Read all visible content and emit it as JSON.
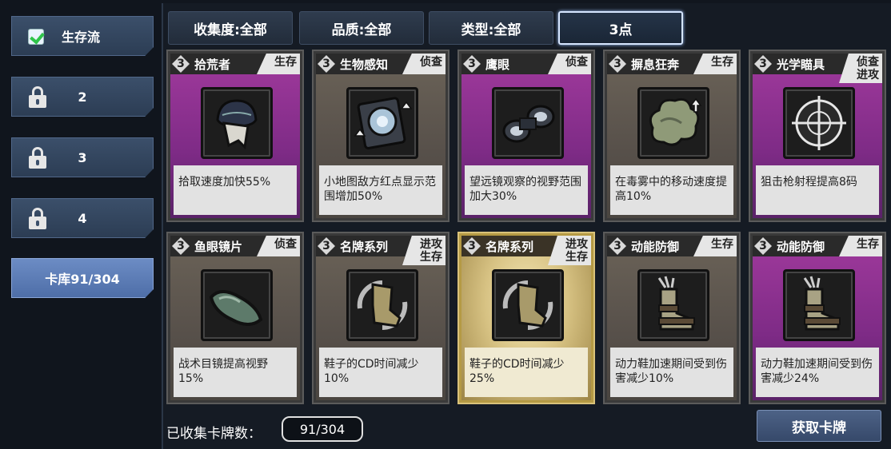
{
  "sidebar": {
    "items": [
      {
        "label": "生存流",
        "state": "checked"
      },
      {
        "label": "2",
        "state": "locked"
      },
      {
        "label": "3",
        "state": "locked"
      },
      {
        "label": "4",
        "state": "locked"
      },
      {
        "label": "卡库91/304",
        "state": "active"
      }
    ]
  },
  "filters": [
    {
      "label": "收集度:全部"
    },
    {
      "label": "品质:全部"
    },
    {
      "label": "类型:全部"
    },
    {
      "label": "3点",
      "selected": true
    }
  ],
  "cards": [
    {
      "cost": "3",
      "name": "拾荒者",
      "tag1": "生存",
      "tag2": "",
      "desc": "拾取速度加快55%",
      "style": "purple",
      "icon": "hood-mask-icon"
    },
    {
      "cost": "3",
      "name": "生物感知",
      "tag1": "侦查",
      "tag2": "",
      "desc": "小地图敌方红点显示范围增加50%",
      "style": "gray",
      "icon": "radar-device-icon"
    },
    {
      "cost": "3",
      "name": "鹰眼",
      "tag1": "侦查",
      "tag2": "",
      "desc": "望远镜观察的视野范围加大30%",
      "style": "purple",
      "icon": "binoculars-icon"
    },
    {
      "cost": "3",
      "name": "摒息狂奔",
      "tag1": "生存",
      "tag2": "",
      "desc": "在毒雾中的移动速度提高10%",
      "style": "gray",
      "icon": "gas-cloud-icon"
    },
    {
      "cost": "3",
      "name": "光学瞄具",
      "tag1": "侦查",
      "tag2": "进攻",
      "desc": "狙击枪射程提高8码",
      "style": "purple",
      "icon": "crosshair-scope-icon"
    },
    {
      "cost": "3",
      "name": "鱼眼镜片",
      "tag1": "侦查",
      "tag2": "",
      "desc": "战术目镜提高视野15%",
      "style": "gray",
      "icon": "goggles-icon"
    },
    {
      "cost": "3",
      "name": "名牌系列",
      "tag1": "进攻",
      "tag2": "生存",
      "desc": "鞋子的CD时间减少10%",
      "style": "gray",
      "icon": "boot-cooldown-icon"
    },
    {
      "cost": "3",
      "name": "名牌系列",
      "tag1": "进攻",
      "tag2": "生存",
      "desc": "鞋子的CD时间减少25%",
      "style": "gold",
      "icon": "boot-cooldown-icon"
    },
    {
      "cost": "3",
      "name": "动能防御",
      "tag1": "生存",
      "tag2": "",
      "desc": "动力鞋加速期间受到伤害减少10%",
      "style": "gray",
      "icon": "armored-boot-icon"
    },
    {
      "cost": "3",
      "name": "动能防御",
      "tag1": "生存",
      "tag2": "",
      "desc": "动力鞋加速期间受到伤害减少24%",
      "style": "purple",
      "icon": "armored-boot-icon"
    }
  ],
  "footer": {
    "collected_label": "已收集卡牌数：",
    "collected_value": "91/304",
    "get_button": "获取卡牌"
  }
}
